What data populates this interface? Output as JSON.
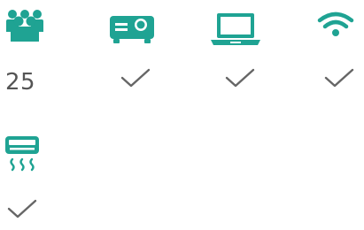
{
  "colors": {
    "accent": "#1fa393",
    "check": "#666666",
    "text": "#555555"
  },
  "amenities": [
    {
      "icon": "people-group-icon",
      "value": "25"
    },
    {
      "icon": "projector-icon",
      "value_icon": "checkmark-icon"
    },
    {
      "icon": "laptop-icon",
      "value_icon": "checkmark-icon"
    },
    {
      "icon": "wifi-icon",
      "value_icon": "checkmark-icon"
    },
    {
      "icon": "air-conditioner-icon",
      "value_icon": "checkmark-icon"
    }
  ]
}
